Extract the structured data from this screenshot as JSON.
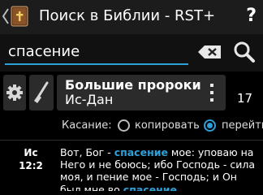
{
  "header": {
    "title": "Поиск в Библии - RST+",
    "help_label": "?",
    "back_icon": "chevron-left-icon",
    "app_icon": "bible-book-icon"
  },
  "search": {
    "query": "спасение",
    "clear_icon": "backspace-icon",
    "search_icon": "search-icon"
  },
  "filter": {
    "settings_icon": "gear-icon",
    "brush_icon": "brush-icon",
    "book_name": "Большие пророки",
    "book_range": "Ис-Дан",
    "more_icon": "more-vert-icon",
    "result_count": "17"
  },
  "touch": {
    "label": "Касание:",
    "options": [
      "копировать",
      "перейти"
    ],
    "selected": "перейти"
  },
  "results": [
    {
      "book": "Ис",
      "ref": "12:2",
      "segments": [
        {
          "text": "Вот, Бог - ",
          "hl": false
        },
        {
          "text": "спасение",
          "hl": true
        },
        {
          "text": " мое: уповаю на Него и не боюсь; ибо Господь - сила моя, и пение мое - Господь; и Он был мне во ",
          "hl": false
        },
        {
          "text": "спасение",
          "hl": true
        },
        {
          "text": ".",
          "hl": false
        }
      ]
    }
  ],
  "colors": {
    "accent": "#2ea0d8",
    "actionbar": "#1c1c1c",
    "button_bg": "#2b2b2b"
  }
}
